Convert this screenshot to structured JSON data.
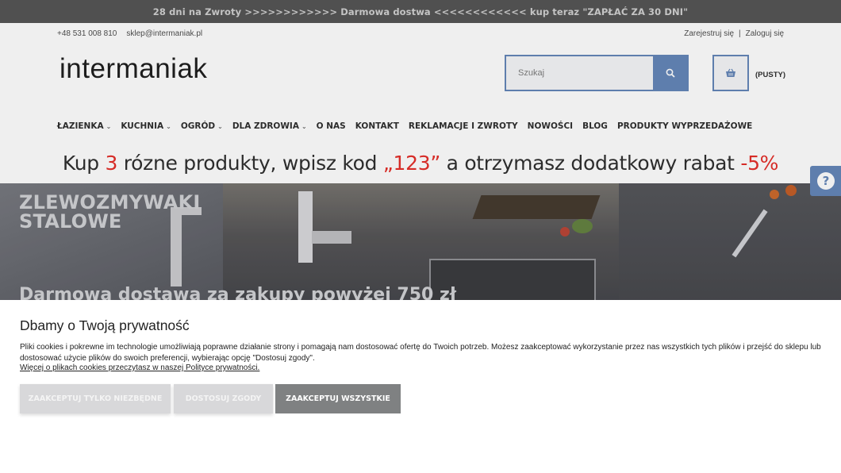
{
  "promo": {
    "text": "28 dni na Zwroty >>>>>>>>>>>> Darmowa dostwa <<<<<<<<<<<< kup teraz \"ZAPŁAĆ ZA 30 DNI\""
  },
  "contact": {
    "phone": "+48 531 008 810",
    "email": "sklep@intermaniak.pl"
  },
  "account": {
    "register": "Zarejestruj się",
    "separator": "|",
    "login": "Zaloguj się"
  },
  "logo": "intermaniak",
  "search": {
    "placeholder": "Szukaj",
    "icon": "search-icon"
  },
  "cart": {
    "icon": "basket-icon",
    "label": "(PUSTY)"
  },
  "nav": {
    "items": [
      {
        "label": "ŁAZIENKA",
        "dropdown": true
      },
      {
        "label": "KUCHNIA",
        "dropdown": true
      },
      {
        "label": "OGRÓD",
        "dropdown": true
      },
      {
        "label": "DLA ZDROWIA",
        "dropdown": true
      },
      {
        "label": "O NAS",
        "dropdown": false
      },
      {
        "label": "KONTAKT",
        "dropdown": false
      },
      {
        "label": "REKLAMACJE I ZWROTY",
        "dropdown": false
      },
      {
        "label": "NOWOŚCI",
        "dropdown": false
      },
      {
        "label": "BLOG",
        "dropdown": false
      },
      {
        "label": "PRODUKTY WYPRZEDAŻOWE",
        "dropdown": false
      }
    ]
  },
  "banner": {
    "part1": "Kup ",
    "number": "3",
    "part2": " rózne produkty, wpisz kod ",
    "code": "„123”",
    "part3": "  a otrzymasz dodatkowy rabat ",
    "discount": "-5%"
  },
  "hero": {
    "title_line1": "ZLEWOZMYWAKI",
    "title_line2": "STALOWE",
    "subtitle": "Darmowa dostawa za zakupy powyżej 750 zł"
  },
  "help": {
    "icon": "question-icon"
  },
  "cookie": {
    "title": "Dbamy o Twoją prywatność",
    "text": "Pliki cookies i pokrewne im technologie umożliwiają poprawne działanie strony i pomagają nam dostosować ofertę do Twoich potrzeb. Możesz zaakceptować wykorzystanie przez nas wszystkich tych plików i przejść do sklepu lub dostosować użycie plików do swoich preferencji, wybierając opcję \"Dostosuj zgody\".",
    "link": "Więcej o plikach cookies przeczytasz w naszej Polityce prywatności.",
    "btn_necessary": "Zaakceptuj tylko niezbędne",
    "btn_customize": "Dostosuj zgody",
    "btn_accept_all": "Zaakceptuj wszystkie"
  },
  "colors": {
    "accent": "#5a7fb4",
    "promo_bg": "#4a4a4a",
    "banner_red": "#e3211c"
  }
}
